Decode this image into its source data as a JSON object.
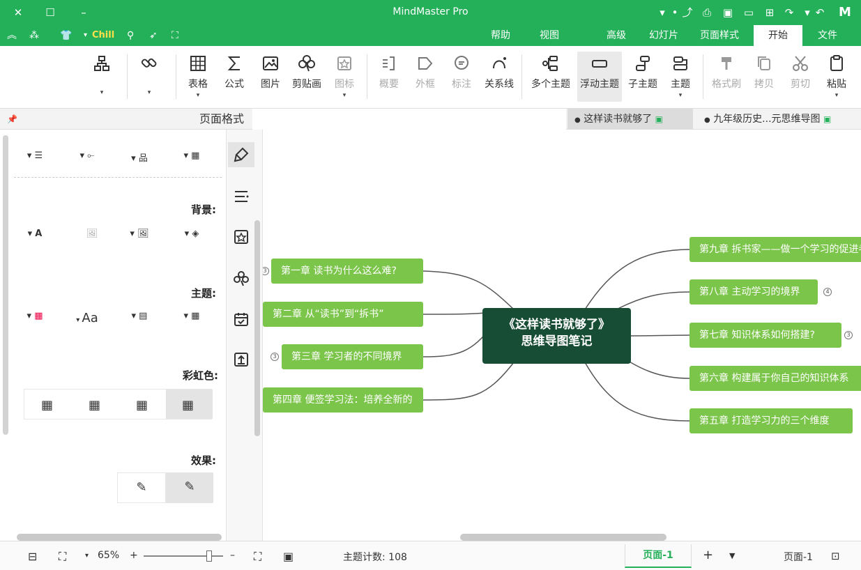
{
  "window": {
    "title": "MindMaster Pro"
  },
  "quick_access": {
    "theme_label": "Chill"
  },
  "ribbon_tabs": [
    {
      "label": "文件"
    },
    {
      "label": "开始"
    },
    {
      "label": "页面样式"
    },
    {
      "label": "幻灯片"
    },
    {
      "label": "高级"
    },
    {
      "label": "视图"
    },
    {
      "label": "帮助"
    }
  ],
  "ribbon": {
    "paste": "粘贴",
    "cut": "剪切",
    "copy": "拷贝",
    "format_painter": "格式刷",
    "topic": "主题",
    "subtopic": "子主题",
    "floating_topic": "浮动主题",
    "multiple_topics": "多个主题",
    "relationship": "关系线",
    "callout": "标注",
    "boundary": "外框",
    "summary": "概要",
    "icon": "图标",
    "clipart": "剪贴画",
    "picture": "图片",
    "formula": "公式",
    "table": "表格"
  },
  "doc_tabs": [
    {
      "label": "九年级历史...元思维导图"
    },
    {
      "label": "这样读书就够了"
    }
  ],
  "panel": {
    "title": "页面格式",
    "background_label": "背景:",
    "theme_label": "主题:",
    "rainbow_label": "彩虹色:",
    "effect_label": "效果:",
    "font_sample": "Aa"
  },
  "mindmap": {
    "central": {
      "line1": "《这样读书就够了》",
      "line2": "思维导图笔记"
    },
    "left_topics": [
      {
        "text": "第一章 读书为什么这么难?",
        "badge": "3"
      },
      {
        "text": "第二章 从“读书”到“拆书”",
        "badge": ""
      },
      {
        "text": "第三章 学习者的不同境界",
        "badge": "3"
      },
      {
        "text": "第四章 便签学习法：培养全新的",
        "badge": ""
      }
    ],
    "right_topics": [
      {
        "text": "第九章 拆书家——做一个学习的促进者",
        "badge": ""
      },
      {
        "text": "第八章 主动学习的境界",
        "badge": "4"
      },
      {
        "text": "第七章 知识体系如何搭建?",
        "badge": "3"
      },
      {
        "text": "第六章 构建属于你自己的知识体系",
        "badge": ""
      },
      {
        "text": "第五章 打造学习力的三个维度",
        "badge": ""
      }
    ],
    "colors": {
      "central_bg": "#184d35",
      "topic_bg": "#7cc54b",
      "line": "#555555",
      "brand": "#24b059"
    }
  },
  "status": {
    "zoom": "65%",
    "topic_count_label": "主题计数: 108",
    "page_tab": "页面-1",
    "page_label": "页面-1"
  }
}
